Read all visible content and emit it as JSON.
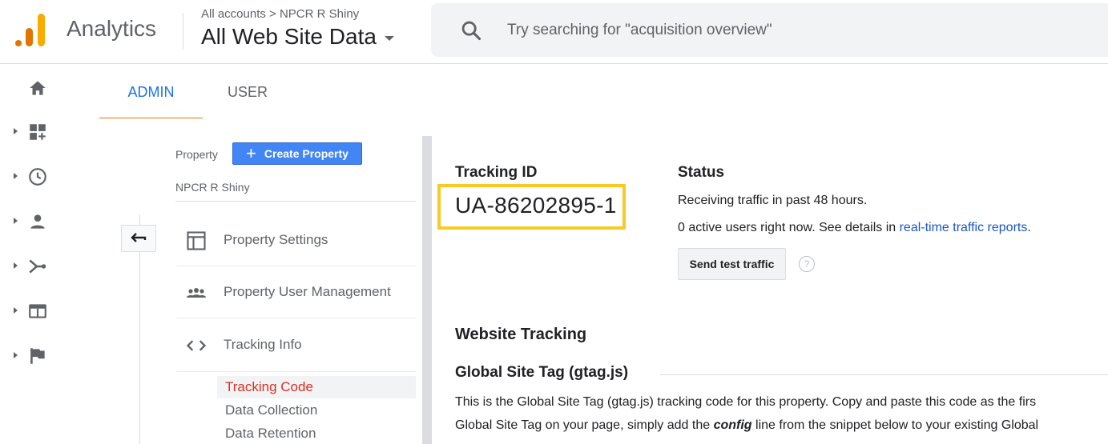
{
  "header": {
    "app_name": "Analytics",
    "account_path": "All accounts > NPCR R Shiny",
    "view_name": "All Web Site Data",
    "search_placeholder": "Try searching for \"acquisition overview\""
  },
  "rail": {
    "items": [
      "home-icon",
      "customization-icon",
      "realtime-icon",
      "audience-icon",
      "acquisition-icon",
      "behavior-icon",
      "conversions-icon"
    ]
  },
  "tabs": {
    "admin": "ADMIN",
    "user": "USER"
  },
  "property": {
    "label": "Property",
    "create_button": "Create Property",
    "name": "NPCR R Shiny",
    "menu": {
      "settings": "Property Settings",
      "user_management": "Property User Management",
      "tracking_info": "Tracking Info"
    },
    "submenu": {
      "tracking_code": "Tracking Code",
      "data_collection": "Data Collection",
      "data_retention": "Data Retention"
    }
  },
  "tracking": {
    "heading": "Tracking ID",
    "id": "UA-86202895-1"
  },
  "status": {
    "heading": "Status",
    "line1": "Receiving traffic in past 48 hours.",
    "line2_prefix": "0 active users right now. See details in ",
    "line2_link": "real-time traffic reports",
    "line2_suffix": ".",
    "test_button": "Send test traffic",
    "help": "?"
  },
  "website_tracking": {
    "heading": "Website Tracking",
    "gtag_heading": "Global Site Tag (gtag.js)",
    "para_line1": "This is the Global Site Tag (gtag.js) tracking code for this property. Copy and paste this code as the firs",
    "para_line2_prefix": "Global Site Tag on your page, simply add the ",
    "para_line2_em": "config",
    "para_line2_suffix": " line from the snippet below to your existing Global"
  },
  "colors": {
    "accent_blue": "#1a73e8",
    "tab_underline": "#e37400",
    "highlight_box": "#f9ca24",
    "active_submenu": "#d93025"
  }
}
